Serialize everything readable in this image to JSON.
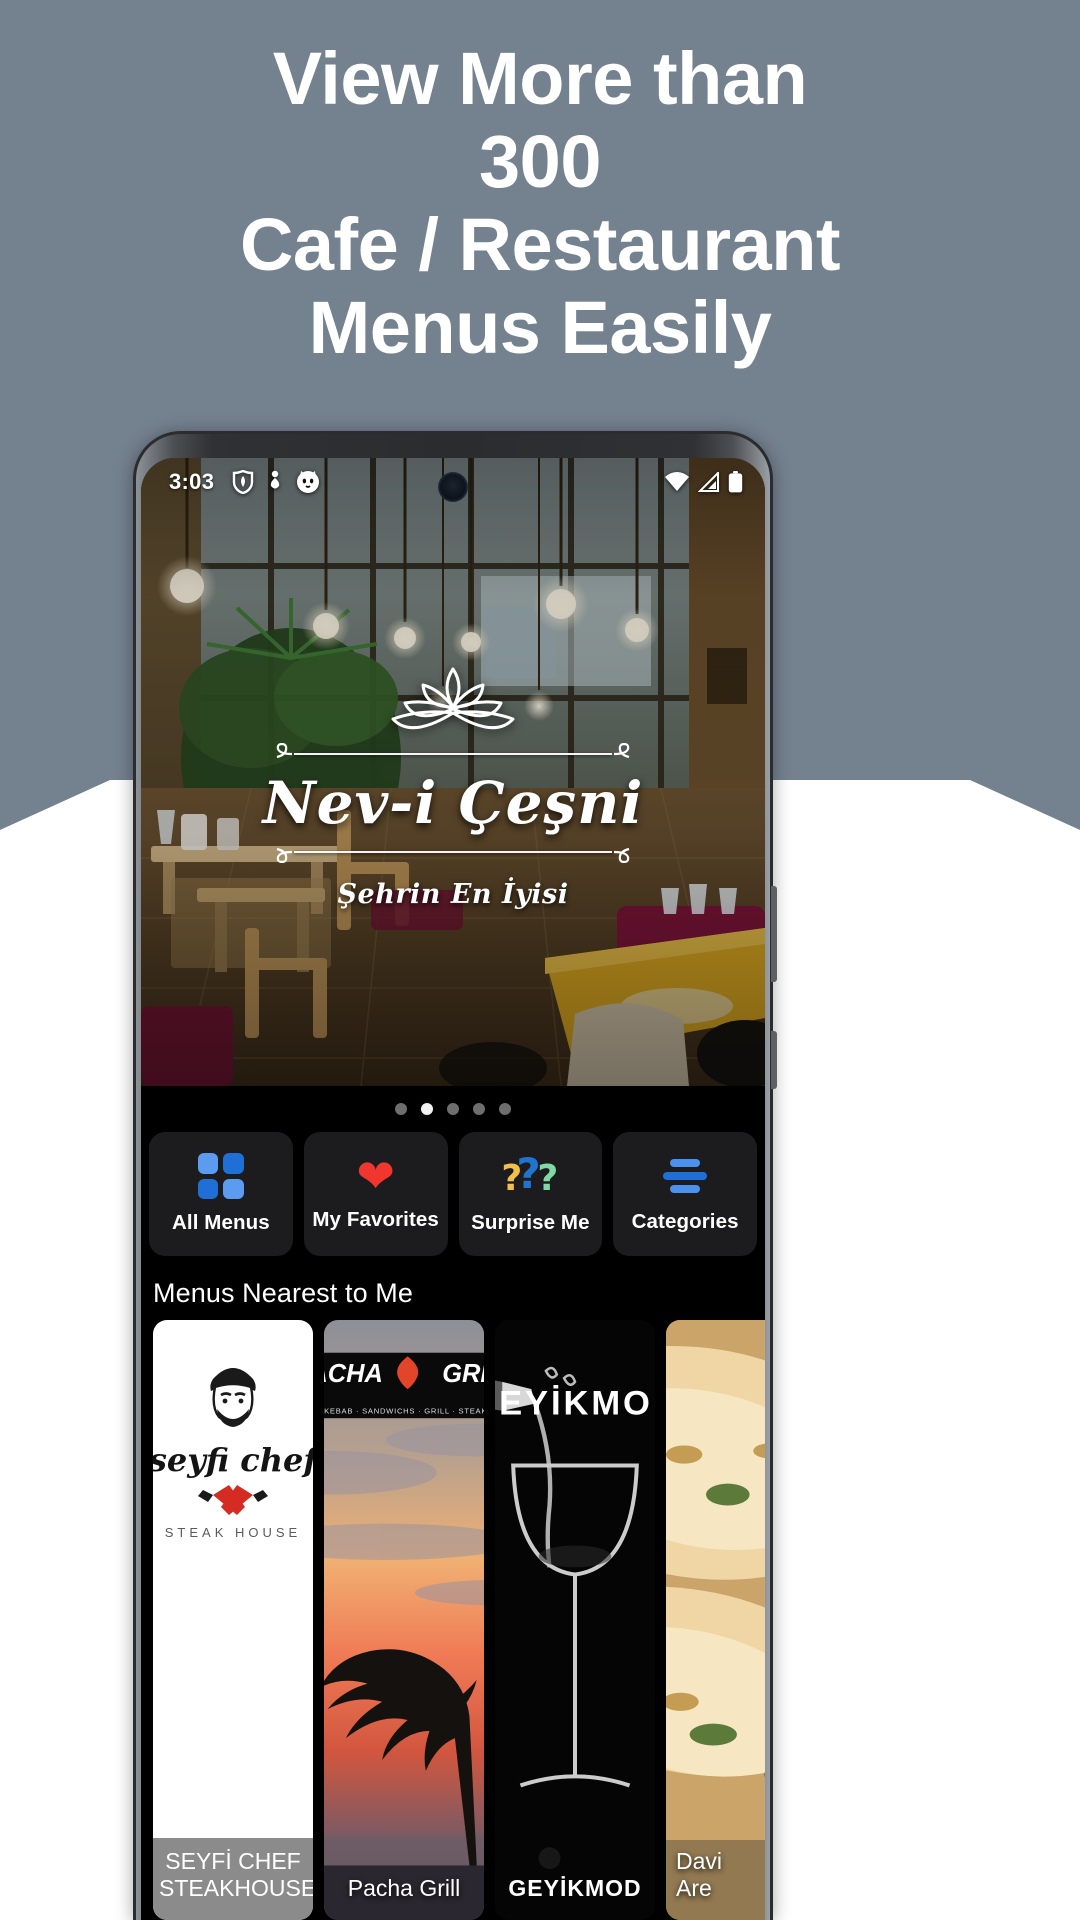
{
  "promo": {
    "background_color": "#74818f",
    "headline_lines": [
      "View More than",
      "300",
      "Cafe / Restaurant",
      "Menus Easily"
    ],
    "text_color": "#ffffff"
  },
  "phone": {
    "statusbar": {
      "time": "3:03",
      "left_icons": [
        "shield-icon",
        "person-walk-icon",
        "cat-face-icon"
      ],
      "right_icons": [
        "wifi-icon",
        "cellular-signal-icon",
        "battery-icon"
      ],
      "camera": "front-camera-punchhole"
    },
    "hero": {
      "logo_icon": "lotus-flower-icon",
      "brand_name": "Nev-i Çeşni",
      "tagline": "Şehrin En İyisi"
    },
    "carousel": {
      "dot_count": 5,
      "active_index": 1
    },
    "actions": [
      {
        "label": "All Menus",
        "icon": "grid-squares-icon",
        "color": "#3b82f6"
      },
      {
        "label": "My Favorites",
        "icon": "heart-icon",
        "color": "#f0362f"
      },
      {
        "label": "Surprise Me",
        "icon": "question-marks-icon",
        "color": "#2f7fe0"
      },
      {
        "label": "Categories",
        "icon": "horizontal-bars-icon",
        "color": "#2f7fe0"
      }
    ],
    "nearest": {
      "section_title": "Menus Nearest to Me",
      "cards": [
        {
          "name": "SEYFİ CHEF\nSTEAKHOUSE",
          "logo_text": "seyfi chef",
          "logo_sub": "STEAK HOUSE",
          "art": "chef-portrait-with-crossed-cleavers"
        },
        {
          "name": "Pacha Grill",
          "logo_main": "PACHA",
          "logo_main2": "GRILL",
          "logo_sub": "DÖNER KEBAB · SANDWICHS · GRILL · STEAKHOUSE",
          "art": "sunset-tree-silhouette-over-sea"
        },
        {
          "name": "GEYİKMOD",
          "logo_text": "GEYİKMOD",
          "art": "wine-being-poured-into-glass-on-black"
        },
        {
          "name": "Davi\nAre",
          "art": "pizza-slices-closeup"
        }
      ]
    }
  }
}
